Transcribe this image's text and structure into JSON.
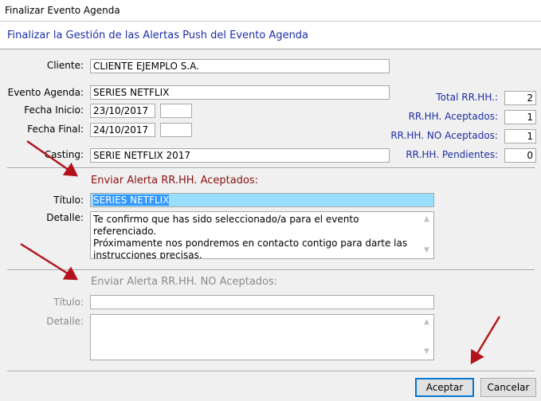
{
  "window": {
    "title": "Finalizar Evento Agenda"
  },
  "header": {
    "title": "Finalizar la Gestión de las Alertas Push del Evento Agenda"
  },
  "form": {
    "cliente_label": "Cliente:",
    "cliente_value": "CLIENTE EJEMPLO S.A.",
    "evento_label": "Evento Agenda:",
    "evento_value": "SERIES NETFLIX",
    "fecha_inicio_label": "Fecha Inicio:",
    "fecha_inicio_value": "23/10/2017",
    "fecha_inicio_time": "",
    "fecha_final_label": "Fecha Final:",
    "fecha_final_value": "24/10/2017",
    "fecha_final_time": "",
    "casting_label": "Casting:",
    "casting_value": "SERIE NETFLIX 2017"
  },
  "stats": {
    "total_label": "Total RR.HH.:",
    "total_value": "2",
    "aceptados_label": "RR.HH. Aceptados:",
    "aceptados_value": "1",
    "no_aceptados_label": "RR.HH. NO Aceptados:",
    "no_aceptados_value": "1",
    "pendientes_label": "RR.HH. Pendientes:",
    "pendientes_value": "0"
  },
  "alerta_aceptados": {
    "heading": "Enviar Alerta RR.HH. Aceptados:",
    "titulo_label": "Título:",
    "titulo_value": "SERIES NETFLIX",
    "detalle_label": "Detalle:",
    "detalle_line1": "Te confirmo que has sido seleccionado/a para el evento referenciado.",
    "detalle_line2": "Próximamente nos pondremos en contacto contigo para darte las",
    "detalle_line3": "instrucciones precisas."
  },
  "alerta_no_aceptados": {
    "heading": "Enviar Alerta RR.HH. NO Aceptados:",
    "titulo_label": "Título:",
    "titulo_value": "",
    "detalle_label": "Detalle:",
    "detalle_value": ""
  },
  "buttons": {
    "aceptar_label": "Aceptar",
    "cancelar_label": "Cancelar"
  },
  "colors": {
    "header_text": "#1c2ea3",
    "section_active": "#8b1010",
    "section_disabled": "#8a8a8a",
    "arrow": "#b3121a",
    "selection": "#3399ff"
  }
}
